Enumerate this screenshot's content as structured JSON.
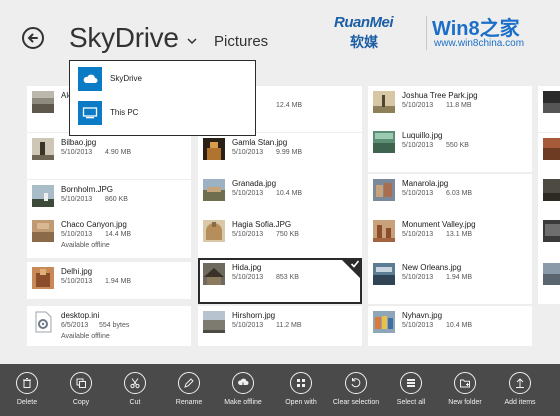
{
  "header": {
    "title": "SkyDrive",
    "breadcrumb": "Pictures"
  },
  "watermark": {
    "brand_latin": "RuanMei",
    "brand_cn": "软媒",
    "site_name": "Win8之家",
    "site_url": "www.win8china.com"
  },
  "location_menu": {
    "items": [
      {
        "label": "SkyDrive",
        "icon": "cloud-icon"
      },
      {
        "label": "This PC",
        "icon": "computer-icon"
      }
    ]
  },
  "files": {
    "col1": [
      {
        "name": "Ale",
        "date": "",
        "size": "",
        "offline": ""
      },
      {
        "name": "Bilbao.jpg",
        "date": "5/10/2013",
        "size": "4.90 MB",
        "offline": ""
      },
      {
        "name": "Bornholm.JPG",
        "date": "5/10/2013",
        "size": "860 KB",
        "offline": ""
      },
      {
        "name": "Chaco Canyon.jpg",
        "date": "5/10/2013",
        "size": "14.4 MB",
        "offline": "Available offline"
      },
      {
        "name": "Delhi.jpg",
        "date": "5/10/2013",
        "size": "1.94 MB",
        "offline": ""
      },
      {
        "name": "desktop.ini",
        "date": "6/5/2013",
        "size": "554 bytes",
        "offline": "Available offline"
      }
    ],
    "col2": [
      {
        "name": "",
        "date": "",
        "size": "12.4 MB",
        "offline": ""
      },
      {
        "name": "Gamla Stan.jpg",
        "date": "5/10/2013",
        "size": "9.99 MB",
        "offline": ""
      },
      {
        "name": "Granada.jpg",
        "date": "5/10/2013",
        "size": "10.4 MB",
        "offline": ""
      },
      {
        "name": "Hagia Sofia.JPG",
        "date": "5/10/2013",
        "size": "750 KB",
        "offline": ""
      },
      {
        "name": "Hida.jpg",
        "date": "5/10/2013",
        "size": "853 KB",
        "offline": "",
        "selected": true
      },
      {
        "name": "Hirshorn.jpg",
        "date": "5/10/2013",
        "size": "11.2 MB",
        "offline": ""
      }
    ],
    "col3": [
      {
        "name": "Joshua Tree Park.jpg",
        "date": "5/10/2013",
        "size": "11.8 MB",
        "offline": ""
      },
      {
        "name": "Luquillo.jpg",
        "date": "5/10/2013",
        "size": "550 KB",
        "offline": ""
      },
      {
        "name": "Manarola.jpg",
        "date": "5/10/2013",
        "size": "6.03 MB",
        "offline": ""
      },
      {
        "name": "Monument Valley.jpg",
        "date": "5/10/2013",
        "size": "13.1 MB",
        "offline": ""
      },
      {
        "name": "New Orleans.jpg",
        "date": "5/10/2013",
        "size": "1.94 MB",
        "offline": ""
      },
      {
        "name": "Nyhavn.jpg",
        "date": "5/10/2013",
        "size": "10.4 MB",
        "offline": ""
      }
    ]
  },
  "app_bar": {
    "commands": [
      {
        "label": "Delete",
        "icon": "trash-icon"
      },
      {
        "label": "Copy",
        "icon": "copy-icon"
      },
      {
        "label": "Cut",
        "icon": "scissors-icon"
      },
      {
        "label": "Rename",
        "icon": "rename-icon"
      },
      {
        "label": "Make offline",
        "icon": "cloud-download-icon"
      },
      {
        "label": "Open with",
        "icon": "open-with-icon"
      },
      {
        "label": "Clear selection",
        "icon": "clear-selection-icon"
      },
      {
        "label": "Select all",
        "icon": "select-all-icon"
      },
      {
        "label": "New folder",
        "icon": "new-folder-icon"
      },
      {
        "label": "Add items",
        "icon": "add-items-icon"
      }
    ]
  },
  "colors": {
    "background": "#eeeeee",
    "tile": "#ffffff",
    "app_bar": "#4a4a4a",
    "accent_blue": "#0a7bc4"
  }
}
